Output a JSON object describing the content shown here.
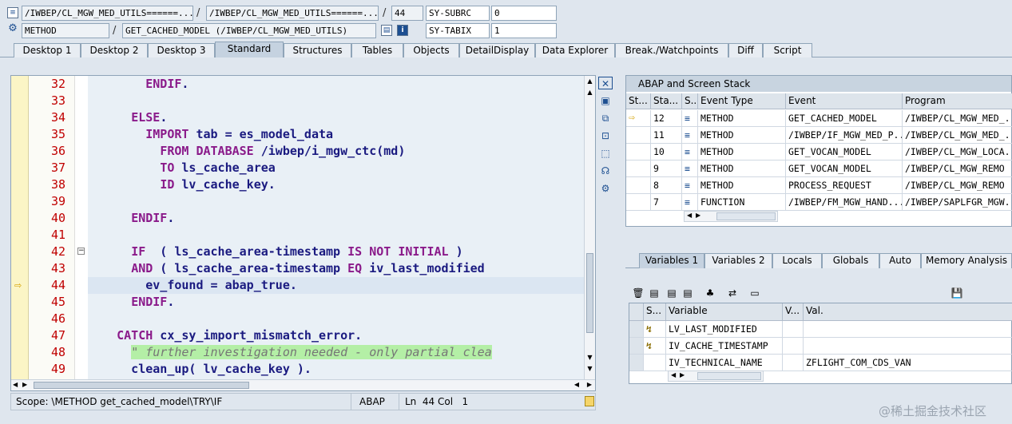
{
  "header": {
    "row1": {
      "program": "/IWBEP/CL_MGW_MED_UTILS======...",
      "include": "/IWBEP/CL_MGW_MED_UTILS======...",
      "line": "44",
      "sy_subrc_label": "SY-SUBRC",
      "sy_subrc_value": "0"
    },
    "row2": {
      "type": "METHOD",
      "event": "GET_CACHED_MODEL (/IWBEP/CL_MGW_MED_UTILS)",
      "sy_tabix_label": "SY-TABIX",
      "sy_tabix_value": "1"
    },
    "slash": "/"
  },
  "tabs": [
    "Desktop 1",
    "Desktop 2",
    "Desktop 3",
    "Standard",
    "Structures",
    "Tables",
    "Objects",
    "DetailDisplay",
    "Data Explorer",
    "Break./Watchpoints",
    "Diff",
    "Script"
  ],
  "active_tab": "Standard",
  "editor": {
    "lines": [
      {
        "no": "32",
        "text": "        ENDIF."
      },
      {
        "no": "33",
        "text": ""
      },
      {
        "no": "34",
        "text": "      ELSE."
      },
      {
        "no": "35",
        "text": "        IMPORT tab = es_model_data"
      },
      {
        "no": "36",
        "text": "          FROM DATABASE /iwbep/i_mgw_ctc(md)"
      },
      {
        "no": "37",
        "text": "          TO ls_cache_area"
      },
      {
        "no": "38",
        "text": "          ID lv_cache_key."
      },
      {
        "no": "39",
        "text": ""
      },
      {
        "no": "40",
        "text": "      ENDIF."
      },
      {
        "no": "41",
        "text": ""
      },
      {
        "no": "42",
        "text": "      IF  ( ls_cache_area-timestamp IS NOT INITIAL )"
      },
      {
        "no": "43",
        "text": "      AND ( ls_cache_area-timestamp EQ iv_last_modified"
      },
      {
        "no": "44",
        "text": "        ev_found = abap_true."
      },
      {
        "no": "45",
        "text": "      ENDIF."
      },
      {
        "no": "46",
        "text": ""
      },
      {
        "no": "47",
        "text": "    CATCH cx_sy_import_mismatch_error."
      },
      {
        "no": "48",
        "text": "      \" further investigation needed - only partial clea"
      },
      {
        "no": "49",
        "text": "      clean_up( lv_cache_key )."
      }
    ],
    "current_line": "44"
  },
  "status": {
    "scope": "Scope: \\METHOD get_cached_model\\TRY\\IF",
    "lang": "ABAP",
    "pos": "Ln  44 Col   1"
  },
  "stack": {
    "title": "ABAP and Screen Stack",
    "columns": [
      "St...",
      "Sta...",
      "S...",
      "Event Type",
      "Event",
      "Program"
    ],
    "rows": [
      {
        "level": "12",
        "type": "METHOD",
        "event": "GET_CACHED_MODEL",
        "program": "/IWBEP/CL_MGW_MED_...",
        "current": true
      },
      {
        "level": "11",
        "type": "METHOD",
        "event": "/IWBEP/IF_MGW_MED_P...",
        "program": "/IWBEP/CL_MGW_MED_...",
        "current": false
      },
      {
        "level": "10",
        "type": "METHOD",
        "event": "GET_VOCAN_MODEL",
        "program": "/IWBEP/CL_MGW_LOCA...",
        "current": false
      },
      {
        "level": "9",
        "type": "METHOD",
        "event": "GET_VOCAN_MODEL",
        "program": "/IWBEP/CL_MGW_REMO",
        "current": false
      },
      {
        "level": "8",
        "type": "METHOD",
        "event": "PROCESS_REQUEST",
        "program": "/IWBEP/CL_MGW_REMO",
        "current": false
      },
      {
        "level": "7",
        "type": "FUNCTION",
        "event": "/IWBEP/FM_MGW_HAND...",
        "program": "/IWBEP/SAPLFGR_MGW...",
        "current": false
      }
    ]
  },
  "var_tabs": [
    "Variables 1",
    "Variables 2",
    "Locals",
    "Globals",
    "Auto",
    "Memory Analysis"
  ],
  "active_var_tab": "Variables 1",
  "variables": {
    "columns": [
      "S...",
      "Variable",
      "V...",
      "Val."
    ],
    "rows": [
      {
        "name": "LV_LAST_MODIFIED",
        "value": "",
        "icon": true
      },
      {
        "name": "IV_CACHE_TIMESTAMP",
        "value": "",
        "icon": true
      },
      {
        "name": "IV_TECHNICAL_NAME",
        "value": "ZFLIGHT_COM_CDS_VAN",
        "icon": false
      }
    ]
  },
  "watermark": "@稀土掘金技术社区"
}
